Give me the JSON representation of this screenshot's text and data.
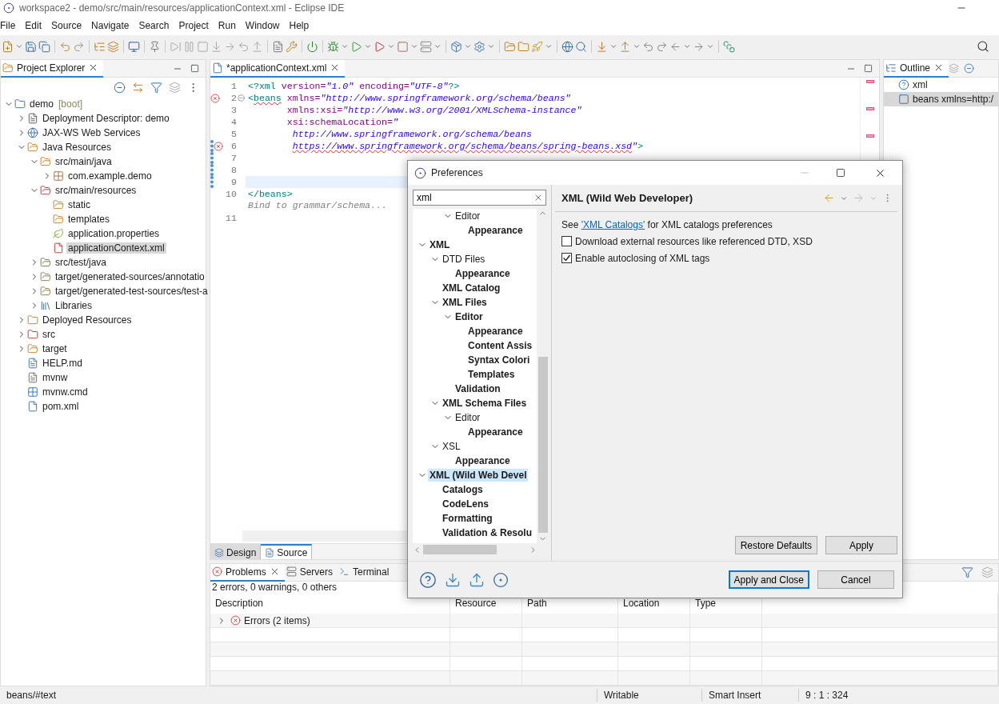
{
  "window": {
    "title": "workspace2 - demo/src/main/resources/applicationContext.xml - Eclipse IDE"
  },
  "menu": [
    "File",
    "Edit",
    "Source",
    "Navigate",
    "Search",
    "Project",
    "Run",
    "Window",
    "Help"
  ],
  "project_explorer": {
    "title": "Project Explorer",
    "tree": [
      {
        "label": "demo",
        "suffix": "[boot]",
        "kind": "project",
        "expanded": true,
        "selected": false,
        "children": [
          {
            "label": "Deployment Descriptor: demo",
            "kind": "descriptor",
            "expanded": false,
            "selected": false
          },
          {
            "label": "JAX-WS Web Services",
            "kind": "webservice",
            "expanded": false,
            "selected": false
          },
          {
            "label": "Java Resources",
            "kind": "javares",
            "expanded": true,
            "selected": false,
            "children": [
              {
                "label": "src/main/java",
                "kind": "srcfolder",
                "expanded": true,
                "selected": false,
                "children": [
                  {
                    "label": "com.example.demo",
                    "kind": "package",
                    "expanded": false,
                    "selected": false
                  }
                ]
              },
              {
                "label": "src/main/resources",
                "kind": "srcfolder-error",
                "expanded": true,
                "selected": false,
                "children": [
                  {
                    "label": "static",
                    "kind": "folder",
                    "selected": false
                  },
                  {
                    "label": "templates",
                    "kind": "folder",
                    "selected": false
                  },
                  {
                    "label": "application.properties",
                    "kind": "properties",
                    "selected": false
                  },
                  {
                    "label": "applicationContext.xml",
                    "kind": "xml-error",
                    "selected": true
                  }
                ]
              },
              {
                "label": "src/test/java",
                "kind": "testfolder",
                "expanded": false,
                "selected": false
              },
              {
                "label": "target/generated-sources/annotatio",
                "kind": "genfolder",
                "expanded": false,
                "selected": false
              },
              {
                "label": "target/generated-test-sources/test-a",
                "kind": "genfolder",
                "expanded": false,
                "selected": false
              },
              {
                "label": "Libraries",
                "kind": "library",
                "expanded": false,
                "selected": false
              }
            ]
          },
          {
            "label": "Deployed Resources",
            "kind": "deployed",
            "expanded": false,
            "selected": false
          },
          {
            "label": "src",
            "kind": "folder-error",
            "expanded": false,
            "selected": false
          },
          {
            "label": "target",
            "kind": "folder",
            "expanded": false,
            "selected": false
          },
          {
            "label": "HELP.md",
            "kind": "doc",
            "selected": false
          },
          {
            "label": "mvnw",
            "kind": "text",
            "selected": false
          },
          {
            "label": "mvnw.cmd",
            "kind": "cmd",
            "selected": false
          },
          {
            "label": "pom.xml",
            "kind": "maven",
            "selected": false
          }
        ]
      }
    ]
  },
  "editor": {
    "tab": "*applicationContext.xml",
    "lines": [
      {
        "number": "1",
        "error": false,
        "changed": false,
        "current": false,
        "fold": false,
        "segments": [
          {
            "text": "<?xml",
            "kind": "tag"
          },
          {
            "text": " version=",
            "kind": "attr"
          },
          {
            "text": "\"1.0\"",
            "kind": "string"
          },
          {
            "text": " encoding=",
            "kind": "attr"
          },
          {
            "text": "\"UTF-8\"",
            "kind": "string"
          },
          {
            "text": "?>",
            "kind": "tag"
          }
        ]
      },
      {
        "number": "2",
        "error": true,
        "changed": false,
        "current": false,
        "fold": true,
        "segments": [
          {
            "text": "<",
            "kind": "tag"
          },
          {
            "text": "beans",
            "kind": "tag",
            "squiggle": true
          },
          {
            "text": " xmlns=",
            "kind": "attr"
          },
          {
            "text": "\"http://www.springframework.org/schema/beans\"",
            "kind": "string"
          }
        ]
      },
      {
        "number": "3",
        "error": false,
        "changed": false,
        "current": false,
        "fold": false,
        "segments": [
          {
            "text": "       xmlns:xsi=",
            "kind": "attr"
          },
          {
            "text": "\"http://www.w3.org/2001/XMLSchema-instance\"",
            "kind": "string"
          }
        ]
      },
      {
        "number": "4",
        "error": false,
        "changed": false,
        "current": false,
        "fold": false,
        "segments": [
          {
            "text": "       xsi:schemaLocation=",
            "kind": "attr"
          },
          {
            "text": "\"",
            "kind": "string"
          }
        ]
      },
      {
        "number": "5",
        "error": false,
        "changed": false,
        "current": false,
        "fold": false,
        "segments": [
          {
            "text": "        http://www.springframework.org/schema/beans",
            "kind": "string"
          }
        ]
      },
      {
        "number": "6",
        "error": true,
        "changed": true,
        "current": false,
        "fold": false,
        "segments": [
          {
            "text": "        https://www.springframework.org/schema/beans/spring-beans.xsd",
            "kind": "string",
            "squiggle": true
          },
          {
            "text": "\"",
            "kind": "string"
          },
          {
            "text": ">",
            "kind": "tag"
          }
        ]
      },
      {
        "number": "7",
        "error": false,
        "changed": true,
        "current": false,
        "fold": false
      },
      {
        "number": "8",
        "error": false,
        "changed": true,
        "current": false,
        "fold": false
      },
      {
        "number": "9",
        "error": false,
        "changed": true,
        "current": true,
        "fold": false
      },
      {
        "number": "10",
        "error": false,
        "changed": false,
        "current": false,
        "fold": false,
        "hint": "Bind to grammar/schema...",
        "segments": [
          {
            "text": "</beans>",
            "kind": "tag"
          }
        ]
      },
      {
        "number": "11",
        "error": false,
        "changed": false,
        "current": false,
        "fold": false
      }
    ],
    "bottom_tabs": [
      {
        "label": "Design",
        "selected": false
      },
      {
        "label": "Source",
        "selected": true
      }
    ]
  },
  "outline": {
    "title": "Outline",
    "items": [
      {
        "label": "xml",
        "kind": "pi",
        "selected": false
      },
      {
        "label": "beans xmlns=http:/",
        "kind": "element",
        "selected": true
      }
    ]
  },
  "problems": {
    "tabs": [
      {
        "label": "Problems",
        "selected": true
      },
      {
        "label": "Servers",
        "selected": false
      },
      {
        "label": "Terminal",
        "selected": false
      }
    ],
    "summary": "2 errors, 0 warnings, 0 others",
    "columns": [
      "Description",
      "Resource",
      "Path",
      "Location",
      "Type"
    ],
    "rows": [
      {
        "description": "Errors (2 items)",
        "expanded": false
      }
    ]
  },
  "status_bar": {
    "path": "beans/#text",
    "mode": "Writable",
    "insert": "Smart Insert",
    "position": "9 : 1 : 324"
  },
  "preferences": {
    "title": "Preferences",
    "filter": "xml",
    "tree": [
      {
        "children": [
          {
            "children": [
              {
                "label": "Editor",
                "match": false,
                "expanded": true,
                "selected": false,
                "children": [
                  {
                    "label": "Appearance",
                    "match": true,
                    "selected": false
                  }
                ]
              }
            ]
          }
        ]
      },
      {
        "label": "XML",
        "match": true,
        "expanded": true,
        "selected": false,
        "children": [
          {
            "label": "DTD Files",
            "match": false,
            "expanded": true,
            "selected": false,
            "children": [
              {
                "label": "Appearance",
                "match": true,
                "selected": false
              }
            ]
          },
          {
            "label": "XML Catalog",
            "match": true,
            "selected": false
          },
          {
            "label": "XML Files",
            "match": true,
            "expanded": true,
            "selected": false,
            "children": [
              {
                "label": "Editor",
                "match": true,
                "expanded": true,
                "selected": false,
                "children": [
                  {
                    "label": "Appearance",
                    "match": true,
                    "selected": false
                  },
                  {
                    "label": "Content Assis",
                    "match": true,
                    "selected": false
                  },
                  {
                    "label": "Syntax Colori",
                    "match": true,
                    "selected": false
                  },
                  {
                    "label": "Templates",
                    "match": true,
                    "selected": false
                  }
                ]
              },
              {
                "label": "Validation",
                "match": true,
                "selected": false
              }
            ]
          },
          {
            "label": "XML Schema Files",
            "match": true,
            "expanded": true,
            "selected": false,
            "children": [
              {
                "label": "Editor",
                "match": false,
                "expanded": true,
                "selected": false,
                "children": [
                  {
                    "label": "Appearance",
                    "match": true,
                    "selected": false
                  }
                ]
              }
            ]
          },
          {
            "label": "XSL",
            "match": false,
            "expanded": true,
            "selected": false,
            "children": [
              {
                "label": "Appearance",
                "match": true,
                "selected": false
              }
            ]
          }
        ]
      },
      {
        "label": "XML (Wild Web Devel",
        "match": true,
        "expanded": true,
        "selected": true,
        "children": [
          {
            "label": "Catalogs",
            "match": true,
            "selected": false
          },
          {
            "label": "CodeLens",
            "match": true,
            "selected": false
          },
          {
            "label": "Formatting",
            "match": true,
            "selected": false
          },
          {
            "label": "Validation & Resolu",
            "match": true,
            "selected": false
          }
        ]
      }
    ],
    "page_title": "XML (Wild Web Developer)",
    "description": {
      "before": "See",
      "link": "'XML Catalogs'",
      "after": "for XML catalogs preferences"
    },
    "options": [
      {
        "label": "Download external resources like referenced DTD, XSD",
        "checked": false
      },
      {
        "label": "Enable autoclosing of XML tags",
        "checked": true
      }
    ],
    "page_buttons": [
      "Restore Defaults",
      "Apply"
    ],
    "buttons": [
      {
        "label": "Apply and Close",
        "default": true
      },
      {
        "label": "Cancel",
        "default": false
      }
    ]
  }
}
